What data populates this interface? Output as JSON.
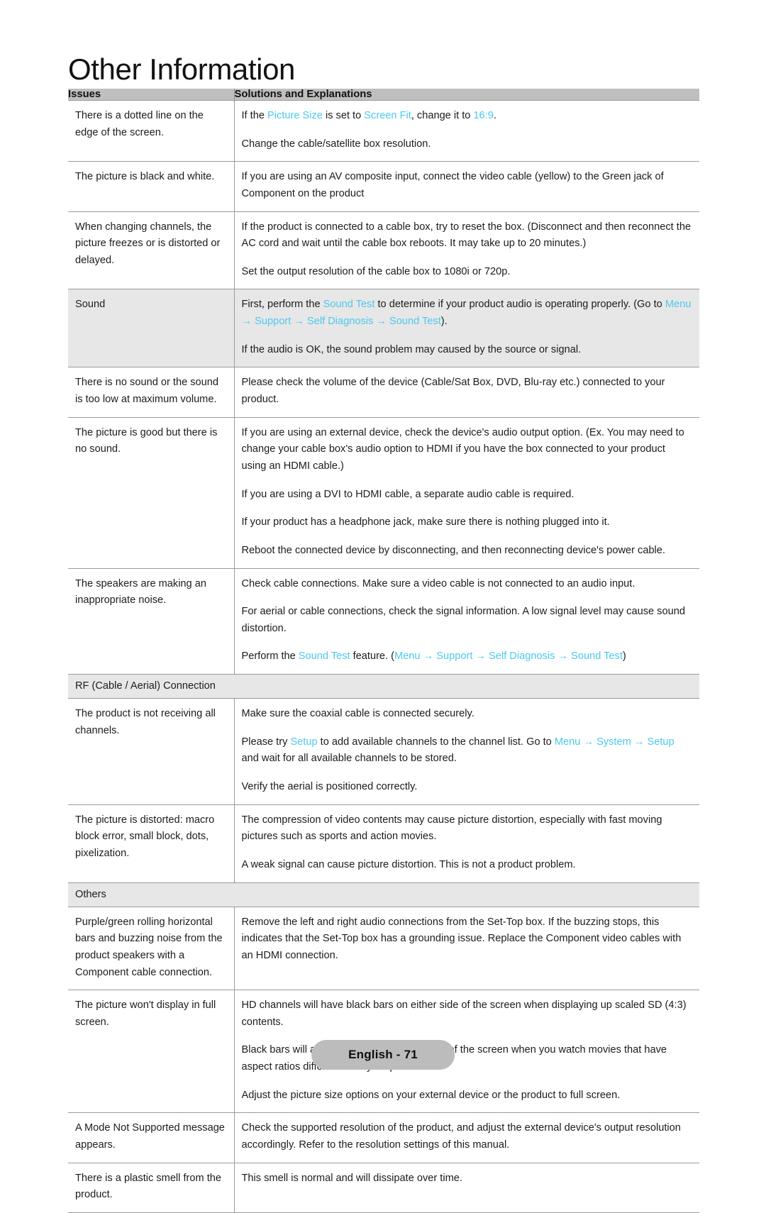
{
  "page": {
    "title": "Other Information",
    "footer_badge": "English - 71",
    "accent_color": "#4cc9f0",
    "header_bg": "#bfbfbf",
    "section_bg": "#e7e7e7"
  },
  "table": {
    "headers": {
      "issues": "Issues",
      "solutions": "Solutions and Explanations"
    },
    "rows": [
      {
        "issue": "There is a dotted line on the edge of the screen.",
        "solutions": [
          "If the |Picture Size| is set to |Screen Fit|, change it to |16:9|.",
          "Change the cable/satellite box resolution."
        ]
      },
      {
        "issue": "The picture is black and white.",
        "solutions": [
          "If you are using an AV composite input, connect the video cable (yellow) to the Green jack of Component on the product"
        ]
      },
      {
        "issue": "When changing channels, the picture freezes or is distorted or delayed.",
        "solutions": [
          "If the product is connected to a cable box, try to reset the box. (Disconnect and then reconnect the AC cord and wait until the cable box reboots. It may take up to 20 minutes.)",
          "Set the output resolution of the cable box to 1080i or 720p."
        ]
      },
      {
        "issue": "Sound",
        "shaded": true,
        "solutions": [
          "First, perform the |Sound Test| to determine if your product audio is operating properly. (Go to |Menu| |→| |Support| |→| |Self Diagnosis| |→| |Sound Test|).",
          "If the audio is OK, the sound problem may caused by the source or signal."
        ]
      },
      {
        "issue": "There is no sound or the sound is too low at maximum volume.",
        "solutions": [
          "Please check the volume of the device (Cable/Sat Box, DVD, Blu-ray etc.) connected to your product."
        ]
      },
      {
        "issue": "The picture is good but there is no sound.",
        "solutions": [
          "If you are using an external device, check the device's audio output option. (Ex. You may need to change your cable box's audio option to HDMI if you have the box connected to your product using an HDMI cable.)",
          "If you are using a DVI to HDMI cable, a separate audio cable is required.",
          "If your product has a headphone jack, make sure there is nothing plugged into it.",
          "Reboot the connected device by disconnecting, and then reconnecting device's power cable."
        ]
      },
      {
        "issue": "The speakers are making an inappropriate noise.",
        "solutions": [
          "Check cable connections. Make sure a video cable is not connected to an audio input.",
          "For aerial or cable connections, check the signal information. A low signal level may cause sound distortion.",
          "Perform the |Sound Test| feature. (|Menu| |→| |Support| |→| |Self Diagnosis| |→| |Sound Test|)"
        ]
      },
      {
        "section": "RF (Cable / Aerial) Connection"
      },
      {
        "issue": "The product is not receiving all channels.",
        "solutions": [
          "Make sure the coaxial cable is connected securely.",
          "Please try |Setup| to add available channels to the channel list. Go to |Menu| |→| |System| |→| |Setup| and wait for all available channels to be stored.",
          "Verify the aerial is positioned correctly."
        ]
      },
      {
        "issue": "The picture is distorted: macro block error, small block, dots, pixelization.",
        "solutions": [
          "The compression of video contents may cause picture distortion, especially with fast moving pictures such as sports and action movies.",
          "A weak signal can cause picture distortion. This is not a product problem."
        ]
      },
      {
        "section": "Others"
      },
      {
        "issue": "Purple/green rolling horizontal bars and buzzing noise from the product speakers with a Component cable connection.",
        "solutions": [
          "Remove the left and right audio connections from the Set-Top box. If the buzzing stops, this indicates that the Set-Top box has a grounding issue. Replace the Component video cables with an HDMI connection."
        ]
      },
      {
        "issue": "The picture won't display in full screen.",
        "solutions": [
          "HD channels will have black bars on either side of the screen when displaying up scaled SD (4:3) contents.",
          "Black bars will appear on the top and bottom of the screen when you watch movies that have aspect ratios different from your product.",
          "Adjust the picture size options on your external device or the product to full screen."
        ]
      },
      {
        "issue": "A Mode Not Supported message appears.",
        "solutions": [
          "Check the supported resolution of the product, and adjust the external device's output resolution accordingly. Refer to the resolution settings of this manual."
        ]
      },
      {
        "issue": "There is a plastic smell from the product.",
        "solutions": [
          "This smell is normal and will dissipate over time."
        ]
      }
    ]
  }
}
